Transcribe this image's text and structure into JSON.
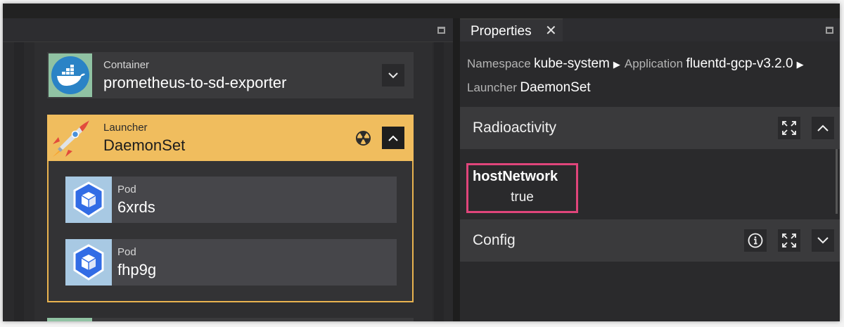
{
  "left_panel": {
    "container_card": {
      "kind": "Container",
      "name": "prometheus-to-sd-exporter",
      "icon": "docker-whale-icon",
      "thumb_color": "#90c2a3"
    },
    "launcher_card": {
      "kind": "Launcher",
      "name": "DaemonSet",
      "icon": "rocket-icon",
      "status_icon": "radioactive-icon",
      "accent_color": "#f0bd5e"
    },
    "pods": [
      {
        "kind": "Pod",
        "name": "6xrds",
        "icon": "kubernetes-pod-icon"
      },
      {
        "kind": "Pod",
        "name": "fhp9g",
        "icon": "kubernetes-pod-icon"
      }
    ]
  },
  "right_panel": {
    "tab": {
      "label": "Properties",
      "close_glyph": "✕"
    },
    "breadcrumb": [
      {
        "key": "Namespace",
        "value": "kube-system"
      },
      {
        "key": "Application",
        "value": "fluentd-gcp-v3.2.0"
      },
      {
        "key": "Launcher",
        "value": "DaemonSet"
      }
    ],
    "sections": {
      "radioactivity": {
        "title": "Radioactivity",
        "expanded": true
      },
      "config": {
        "title": "Config",
        "expanded": false
      }
    },
    "properties": [
      {
        "key": "hostNetwork",
        "value": "true"
      }
    ],
    "highlight_color": "#e0457b"
  }
}
